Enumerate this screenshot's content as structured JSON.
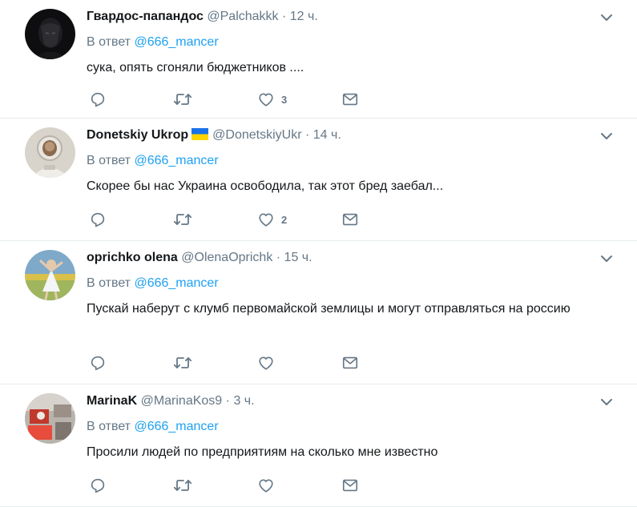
{
  "tweets": [
    {
      "name": "Гвардос-папандос",
      "handle": "@Palchakkk",
      "time": "12 ч.",
      "reply_prefix": "В ответ",
      "reply_to": "@666_mancer",
      "text": "сука, опять сгоняли бюджетников ....",
      "likes": "3",
      "has_flag": false
    },
    {
      "name": "Donetskiy Ukrop",
      "handle": "@DonetskiyUkr",
      "time": "14 ч.",
      "reply_prefix": "В ответ",
      "reply_to": "@666_mancer",
      "text": "Скорее бы нас Украина освободила, так этот бред заебал...",
      "likes": "2",
      "has_flag": true
    },
    {
      "name": "oprichko olena",
      "handle": "@OlenaOprichk",
      "time": "15 ч.",
      "reply_prefix": "В ответ",
      "reply_to": "@666_mancer",
      "text": "Пускай наберут с клумб первомайской землицы и могут отправляться на россию",
      "likes": "",
      "has_flag": false
    },
    {
      "name": "MarinaK",
      "handle": "@MarinaKos9",
      "time": "3 ч.",
      "reply_prefix": "В ответ",
      "reply_to": "@666_mancer",
      "text": "Просили людей по предприятиям на сколько мне известно",
      "likes": "",
      "has_flag": false
    }
  ],
  "separator": "·",
  "colors": {
    "accent": "#1da1f2",
    "muted": "#657786",
    "text": "#14171a",
    "border": "#e6ecf0"
  },
  "icons": {
    "reply": "reply-icon",
    "retweet": "retweet-icon",
    "like": "heart-icon",
    "dm": "envelope-icon",
    "menu": "chevron-down-icon"
  }
}
